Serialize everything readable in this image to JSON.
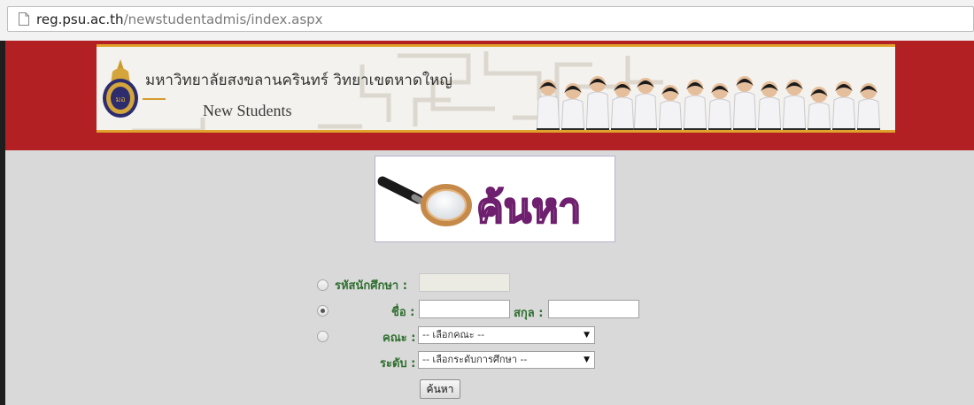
{
  "browser": {
    "url_host": "reg.psu.ac.th",
    "url_path": "/newstudentadmis/index.aspx"
  },
  "banner": {
    "university_name": "มหาวิทยาลัยสงขลานครินทร์ วิทยาเขตหาดใหญ่",
    "subtitle": "New Students"
  },
  "search_image": {
    "text": "ค้นหา"
  },
  "form": {
    "student_id_label": "รหัสนักศึกษา :",
    "name_label": "ชื่อ :",
    "surname_label": "สกุล :",
    "faculty_label": "คณะ :",
    "faculty_select": "-- เลือกคณะ --",
    "level_label": "ระดับ :",
    "level_select": "-- เลือกระดับการศึกษา --",
    "search_button": "ค้นหา",
    "selected_option": "name"
  },
  "colors": {
    "header_red": "#b22024",
    "label_green": "#2f6f2f",
    "page_bg": "#d9d9d9",
    "search_text_purple": "#8e2a8e"
  }
}
